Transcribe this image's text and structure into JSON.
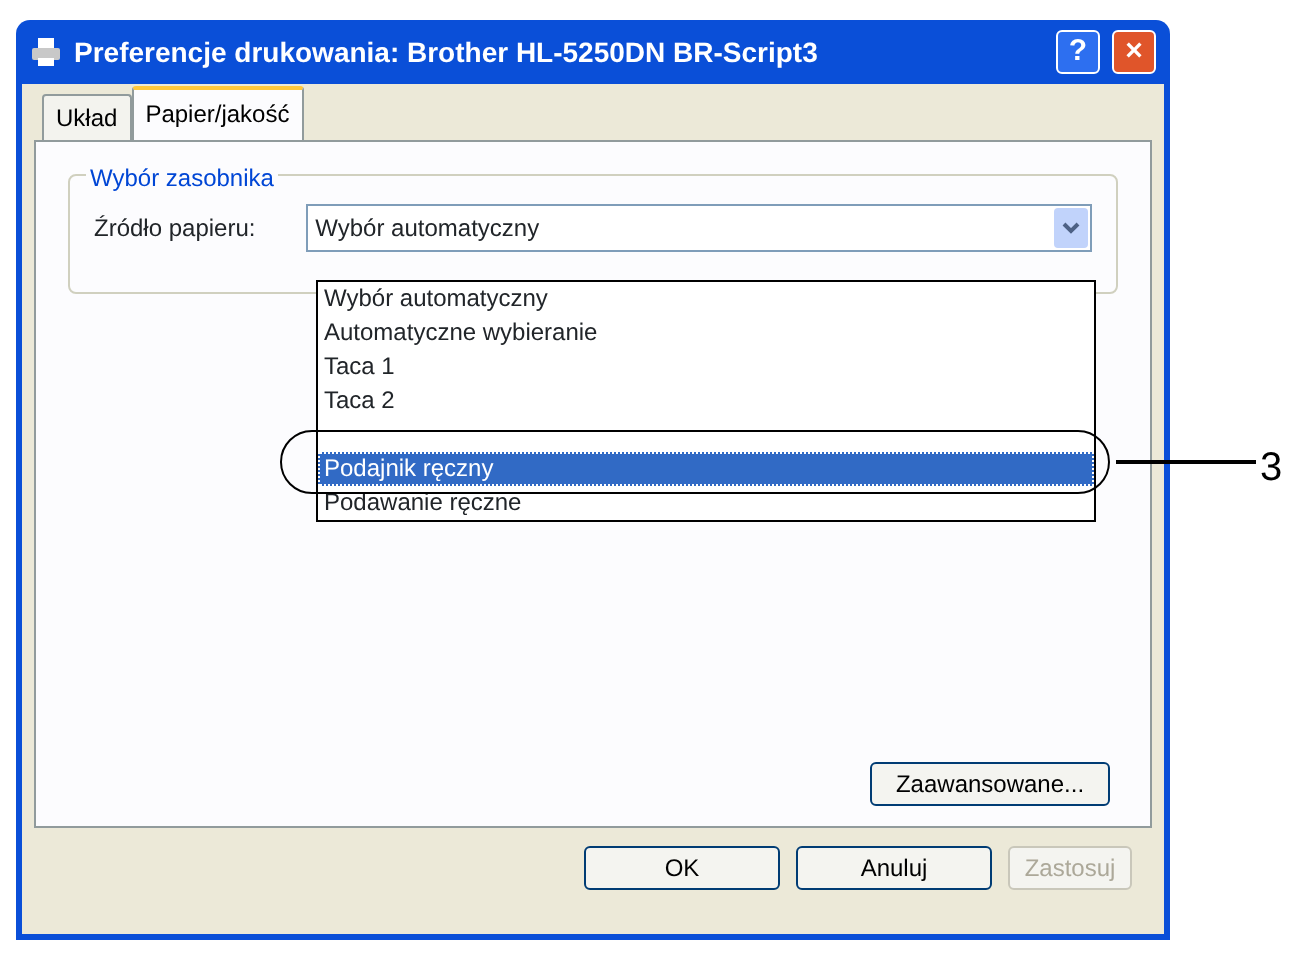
{
  "window": {
    "title": "Preferencje drukowania: Brother HL-5250DN BR-Script3"
  },
  "title_buttons": [
    {
      "kind": "help",
      "label": "?"
    },
    {
      "kind": "close",
      "label": "×"
    }
  ],
  "tabs": [
    {
      "label": "Układ",
      "selected": false
    },
    {
      "label": "Papier/jakość",
      "selected": true
    }
  ],
  "group": {
    "title": "Wybór zasobnika",
    "field_label": "Źródło papieru:",
    "value": "Wybór automatyczny"
  },
  "dropdown": {
    "expanded": true,
    "items": [
      {
        "label": "Wybór automatyczny",
        "selected": false
      },
      {
        "label": "Automatyczne wybieranie",
        "selected": false
      },
      {
        "label": "Taca 1",
        "selected": false
      },
      {
        "label": "Taca 2",
        "selected": false
      },
      {
        "label": "Podajnik ręczny",
        "selected": true
      },
      {
        "label": "Podawanie ręczne",
        "selected": false
      }
    ]
  },
  "advanced_button": "Zaawansowane...",
  "buttons": [
    {
      "label": "OK",
      "disabled": false
    },
    {
      "label": "Anuluj",
      "disabled": false
    },
    {
      "label": "Zastosuj",
      "disabled": true
    }
  ],
  "callout": "3"
}
